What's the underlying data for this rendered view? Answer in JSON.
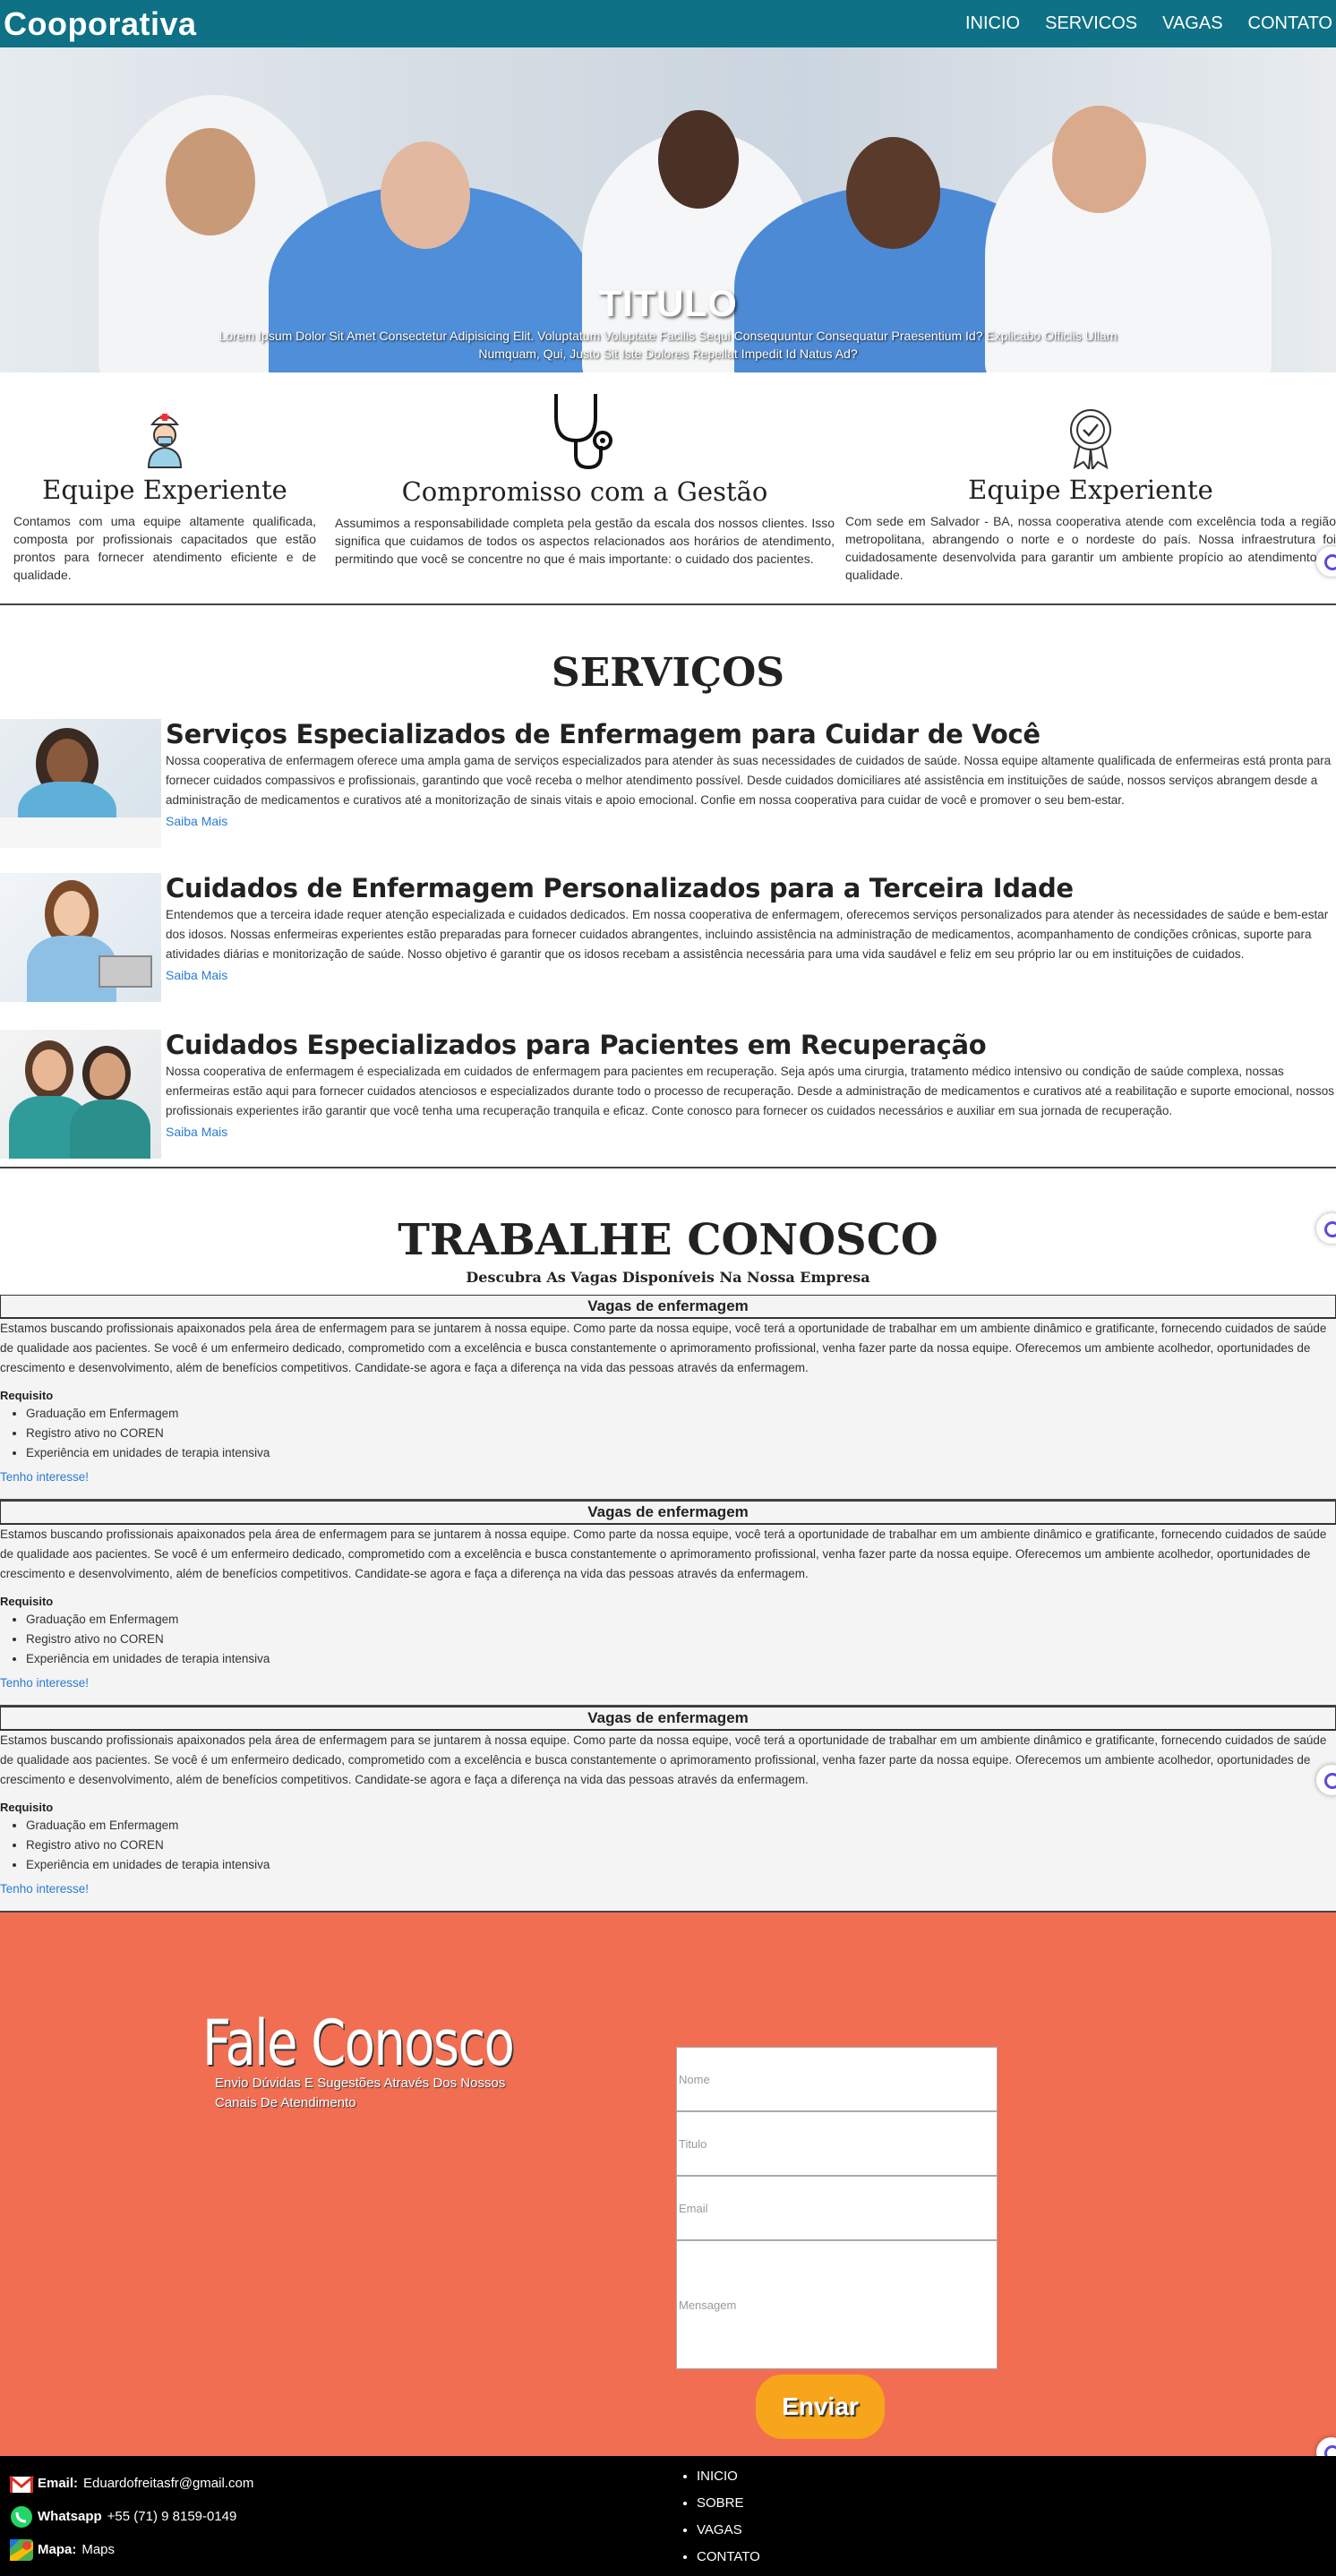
{
  "nav": {
    "brand": "Cooporativa",
    "links": [
      "INICIO",
      "SERVICOS",
      "VAGAS",
      "CONTATO"
    ]
  },
  "hero": {
    "title": "TITULO",
    "subtitle": "Lorem Ipsum Dolor Sit Amet Consectetur Adipisicing Elit. Voluptatum Voluptate Facilis Sequi Consequuntur Consequatur Praesentium Id? Explicabo Officiis Ullam Numquam, Qui, Justo Sit Iste Dolores Repellat Impedit Id Natus Ad?"
  },
  "features": [
    {
      "icon": "nurse-icon",
      "title": "Equipe Experiente",
      "text": "Contamos com uma equipe altamente qualificada, composta por profissionais capacitados que estão prontos para fornecer atendimento eficiente e de qualidade."
    },
    {
      "icon": "stethoscope-icon",
      "title": "Compromisso com a Gestão",
      "text": "Assumimos a responsabilidade completa pela gestão da escala dos nossos clientes. Isso significa que cuidamos de todos os aspectos relacionados aos horários de atendimento, permitindo que você se concentre no que é mais importante: o cuidado dos pacientes."
    },
    {
      "icon": "award-badge-icon",
      "title": "Equipe Experiente",
      "text": "Com sede em Salvador - BA, nossa cooperativa atende com excelência toda a região metropolitana, abrangendo o norte e o nordeste do país. Nossa infraestrutura foi cuidadosamente desenvolvida para garantir um ambiente propício ao atendimento de qualidade."
    }
  ],
  "services": {
    "title": "SERVIÇOS",
    "items": [
      {
        "title": "Serviços Especializados de Enfermagem para Cuidar de Você",
        "text": "Nossa cooperativa de enfermagem oferece uma ampla gama de serviços especializados para atender às suas necessidades de cuidados de saúde. Nossa equipe altamente qualificada de enfermeiras está pronta para fornecer cuidados compassivos e profissionais, garantindo que você receba o melhor atendimento possível. Desde cuidados domiciliares até assistência em instituições de saúde, nossos serviços abrangem desde a administração de medicamentos e curativos até a monitorização de sinais vitais e apoio emocional. Confie em nossa cooperativa para cuidar de você e promover o seu bem-estar.",
        "link": "Saiba Mais"
      },
      {
        "title": "Cuidados de Enfermagem Personalizados para a Terceira Idade",
        "text": "Entendemos que a terceira idade requer atenção especializada e cuidados dedicados. Em nossa cooperativa de enfermagem, oferecemos serviços personalizados para atender às necessidades de saúde e bem-estar dos idosos. Nossas enfermeiras experientes estão preparadas para fornecer cuidados abrangentes, incluindo assistência na administração de medicamentos, acompanhamento de condições crônicas, suporte para atividades diárias e monitorização de saúde. Nosso objetivo é garantir que os idosos recebam a assistência necessária para uma vida saudável e feliz em seu próprio lar ou em instituições de cuidados.",
        "link": "Saiba Mais"
      },
      {
        "title": "Cuidados Especializados para Pacientes em Recuperação",
        "text": "Nossa cooperativa de enfermagem é especializada em cuidados de enfermagem para pacientes em recuperação. Seja após uma cirurgia, tratamento médico intensivo ou condição de saúde complexa, nossas enfermeiras estão aqui para fornecer cuidados atenciosos e especializados durante todo o processo de recuperação. Desde a administração de medicamentos e curativos até a reabilitação e suporte emocional, nossos profissionais experientes irão garantir que você tenha uma recuperação tranquila e eficaz. Conte conosco para fornecer os cuidados necessários e auxiliar em sua jornada de recuperação.",
        "link": "Saiba Mais"
      }
    ]
  },
  "jobs": {
    "title": "TRABALHE CONOSCO",
    "subtitle": "Descubra As Vagas Disponíveis Na Nossa Empresa",
    "items": [
      {
        "title": "Vagas de enfermagem",
        "text": "Estamos buscando profissionais apaixonados pela área de enfermagem para se juntarem à nossa equipe. Como parte da nossa equipe, você terá a oportunidade de trabalhar em um ambiente dinâmico e gratificante, fornecendo cuidados de saúde de qualidade aos pacientes. Se você é um enfermeiro dedicado, comprometido com a excelência e busca constantemente o aprimoramento profissional, venha fazer parte da nossa equipe. Oferecemos um ambiente acolhedor, oportunidades de crescimento e desenvolvimento, além de benefícios competitivos. Candidate-se agora e faça a diferença na vida das pessoas através da enfermagem.",
        "req_label": "Requisito",
        "requirements": [
          "Graduação em Enfermagem",
          "Registro ativo no COREN",
          "Experiência em unidades de terapia intensiva"
        ],
        "link": "Tenho interesse!"
      },
      {
        "title": "Vagas de enfermagem",
        "text": "Estamos buscando profissionais apaixonados pela área de enfermagem para se juntarem à nossa equipe. Como parte da nossa equipe, você terá a oportunidade de trabalhar em um ambiente dinâmico e gratificante, fornecendo cuidados de saúde de qualidade aos pacientes. Se você é um enfermeiro dedicado, comprometido com a excelência e busca constantemente o aprimoramento profissional, venha fazer parte da nossa equipe. Oferecemos um ambiente acolhedor, oportunidades de crescimento e desenvolvimento, além de benefícios competitivos. Candidate-se agora e faça a diferença na vida das pessoas através da enfermagem.",
        "req_label": "Requisito",
        "requirements": [
          "Graduação em Enfermagem",
          "Registro ativo no COREN",
          "Experiência em unidades de terapia intensiva"
        ],
        "link": "Tenho interesse!"
      },
      {
        "title": "Vagas de enfermagem",
        "text": "Estamos buscando profissionais apaixonados pela área de enfermagem para se juntarem à nossa equipe. Como parte da nossa equipe, você terá a oportunidade de trabalhar em um ambiente dinâmico e gratificante, fornecendo cuidados de saúde de qualidade aos pacientes. Se você é um enfermeiro dedicado, comprometido com a excelência e busca constantemente o aprimoramento profissional, venha fazer parte da nossa equipe. Oferecemos um ambiente acolhedor, oportunidades de crescimento e desenvolvimento, além de benefícios competitivos. Candidate-se agora e faça a diferença na vida das pessoas através da enfermagem.",
        "req_label": "Requisito",
        "requirements": [
          "Graduação em Enfermagem",
          "Registro ativo no COREN",
          "Experiência em unidades de terapia intensiva"
        ],
        "link": "Tenho interesse!"
      }
    ]
  },
  "contact": {
    "title": "Fale Conosco",
    "subtitle": "Envio Dúvidas E Sugestões Através Dos Nossos Canais De Atendimento",
    "fields": {
      "name": "Nome",
      "title": "Titulo",
      "email": "Email",
      "message": "Mensagem"
    },
    "send": "Enviar"
  },
  "footer": {
    "email_label": "Email:",
    "email_value": "Eduardofreitasfr@gmail.com",
    "whatsapp_label": "Whatsapp",
    "whatsapp_value": "+55 (71) 9 8159-0149",
    "map_label": "Mapa:",
    "map_value": "Maps",
    "links": [
      "INICIO",
      "SOBRE",
      "VAGAS",
      "CONTATO"
    ]
  },
  "colors": {
    "nav": "#0e7185",
    "contact": "#f16e52",
    "button": "#f7a51b",
    "link": "#2a7bd6"
  }
}
